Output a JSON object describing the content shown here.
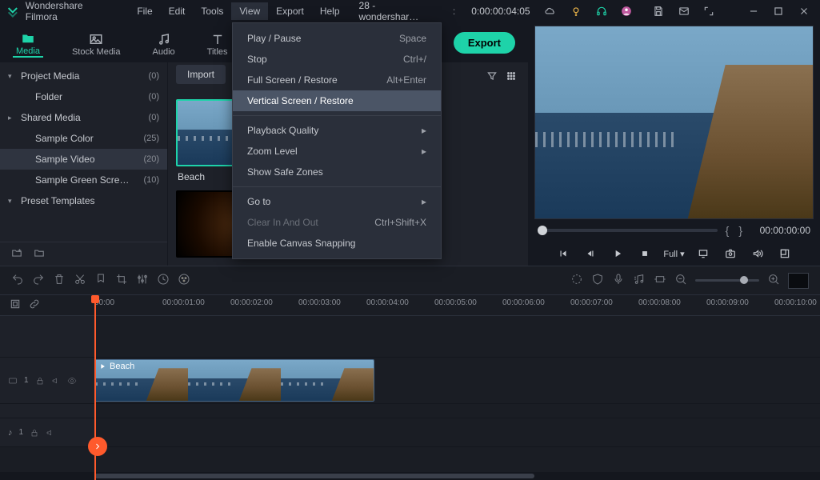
{
  "app_title": "Wondershare Filmora",
  "menubar": [
    "File",
    "Edit",
    "Tools",
    "View",
    "Export",
    "Help"
  ],
  "menubar_open_index": 3,
  "project_label": "28 - wondershar…",
  "project_time": "0:00:00:04:05",
  "dropdown": [
    {
      "label": "Play / Pause",
      "shortcut": "Space",
      "type": "item"
    },
    {
      "label": "Stop",
      "shortcut": "Ctrl+/",
      "type": "item"
    },
    {
      "label": "Full Screen / Restore",
      "shortcut": "Alt+Enter",
      "type": "item"
    },
    {
      "label": "Vertical Screen / Restore",
      "shortcut": "",
      "type": "item",
      "highlighted": true
    },
    {
      "type": "sep"
    },
    {
      "label": "Playback Quality",
      "type": "submenu"
    },
    {
      "label": "Zoom Level",
      "type": "submenu"
    },
    {
      "label": "Show Safe Zones",
      "type": "item"
    },
    {
      "type": "sep"
    },
    {
      "label": "Go to",
      "type": "submenu"
    },
    {
      "label": "Clear In And Out",
      "shortcut": "Ctrl+Shift+X",
      "type": "item",
      "disabled": true
    },
    {
      "label": "Enable Canvas Snapping",
      "type": "item"
    }
  ],
  "tabs": [
    {
      "label": "Media",
      "icon": "folder",
      "active": true
    },
    {
      "label": "Stock Media",
      "icon": "image"
    },
    {
      "label": "Audio",
      "icon": "music"
    },
    {
      "label": "Titles",
      "icon": "text"
    }
  ],
  "export_label": "Export",
  "import_label": "Import",
  "tree": [
    {
      "label": "Project Media",
      "count": "(0)",
      "exp": "▾"
    },
    {
      "label": "Folder",
      "count": "(0)",
      "indent": true
    },
    {
      "label": "Shared Media",
      "count": "(0)",
      "exp": "▸"
    },
    {
      "label": "Sample Color",
      "count": "(25)",
      "indent": true
    },
    {
      "label": "Sample Video",
      "count": "(20)",
      "selected": true,
      "indent": true
    },
    {
      "label": "Sample Green Scre…",
      "count": "(10)",
      "indent": true
    },
    {
      "label": "Preset Templates",
      "exp": "▾"
    }
  ],
  "thumbs": [
    {
      "caption": "Beach",
      "selected": true,
      "kind": "sea"
    },
    {
      "caption": "",
      "kind": "candle"
    },
    {
      "caption": "",
      "kind": "room"
    }
  ],
  "preview": {
    "timecode": "00:00:00:00",
    "speed": "Full ▾"
  },
  "ruler_ticks": [
    "00:00",
    "00:00:01:00",
    "00:00:02:00",
    "00:00:03:00",
    "00:00:04:00",
    "00:00:05:00",
    "00:00:06:00",
    "00:00:07:00",
    "00:00:08:00",
    "00:00:09:00",
    "00:00:10:00"
  ],
  "video_track_label": "1",
  "audio_track_label": "1",
  "clip_name": "Beach"
}
